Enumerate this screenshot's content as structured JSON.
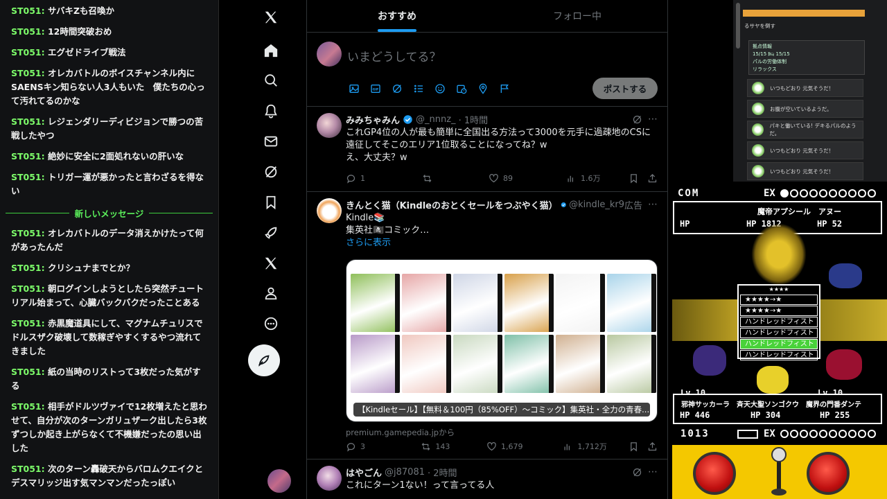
{
  "chat": {
    "messages_top": [
      {
        "user": "ST051:",
        "text": " サバキZも召喚か"
      },
      {
        "user": "ST051:",
        "text": " 12時間突破おめ"
      },
      {
        "user": "ST051:",
        "text": " エグゼドライブ戦法"
      },
      {
        "user": "ST051:",
        "text": " オレカバトルのボイスチャンネル内にSAENSキン知らない人3人もいた　僕たちの心って汚れてるのかな"
      },
      {
        "user": "ST051:",
        "text": " レジェンダリーディビジョンで勝つの苦戦したやつ"
      },
      {
        "user": "ST051:",
        "text": " 絶妙に安全に2面処れないの肝いな"
      },
      {
        "user": "ST051:",
        "text": " トリガー運が悪かったと言わざるを得ない"
      }
    ],
    "divider_label": "新しいメッセージ",
    "messages_bottom": [
      {
        "user": "ST051:",
        "text": " オレカバトルのデータ消えかけたって何があったんだ"
      },
      {
        "user": "ST051:",
        "text": " クリシュナまでとか？"
      },
      {
        "user": "ST051:",
        "text": " 朝ログインしようとしたら突然チュートリアル始まって、心臓バックバクだったことある"
      },
      {
        "user": "ST051:",
        "text": " 赤黒魔道具にして、マグナムチュリスでドルスザク破壊して数稼ぎやすくするやつ流れてきました"
      },
      {
        "user": "ST051:",
        "text": " 紙の当時のリストって3枚だった気がする"
      },
      {
        "user": "ST051:",
        "text": " 相手がドルツヴァイで12枚増えたと思わせて、自分が次のターンガリュザーク出したら3枚ずつしか起き上がらなくて不機嫌だったの思い出した"
      },
      {
        "user": "ST051:",
        "text": " 次のターン轟破天からバロムクエイクとデスマリッジ出す気マンマンだったっぽい"
      }
    ]
  },
  "nav": {
    "icons": [
      "x-logo-icon",
      "home-icon",
      "search-icon",
      "notifications-icon",
      "messages-icon",
      "grok-icon",
      "bookmarks-icon",
      "rocket-icon",
      "premium-x-icon",
      "profile-icon",
      "more-icon"
    ]
  },
  "timeline": {
    "tabs": [
      {
        "label": "おすすめ",
        "active": true
      },
      {
        "label": "フォロー中",
        "active": false
      }
    ],
    "composer": {
      "placeholder": "いまどうしてる？",
      "post_label": "ポストする"
    },
    "tweets": [
      {
        "name": "みみちゃみん",
        "handle": "@_nnnz_",
        "time": "· 1時間",
        "text": "これGP4位の人が最も簡単に全国出る方法って3000を元手に過疎地のCSに遠征してそこのエリア1位取ることになってね？w\nえ、大丈夫？w",
        "replies": "1",
        "retweets": "",
        "likes": "89",
        "views": "1.6万"
      },
      {
        "name": "きんとく猫（Kindleのおとくセールをつぶやく猫）",
        "handle": "@kindle_kr9",
        "ad_label": "広告",
        "text_line1": "Kindle📚",
        "text_line2": "集英社🏴‍☠️コミック…",
        "more": "さらに表示",
        "card_caption": "【Kindleセール】【無料＆100円（85%OFF）～コミック】集英社・全力の青春...",
        "card_source": "premium.gamepedia.jpから",
        "replies": "3",
        "retweets": "143",
        "likes": "1,679",
        "views": "1,712万"
      },
      {
        "name": "はやごん",
        "handle": "@j87081",
        "time": "· 2時間",
        "text": "これにターン1ない！って言ってる人"
      }
    ]
  },
  "game_top": {
    "title": "るサヤを倒す",
    "stats": [
      "拠点情報",
      "15/15   🛏 15/15",
      "パルの労働体制",
      "リラックス"
    ],
    "rows": [
      "いつもどおり 元気そうだ！",
      "お腹が空いているようだ。",
      "パキと働いている! デキるパルのようだ。",
      "いつもどおり 元気そうだ！",
      "いつもどおり 元気そうだ！"
    ]
  },
  "game_bot": {
    "com_label": "COM",
    "ex_label": "EX",
    "enemy_names": "魔帝アプシール　アヌー",
    "enemy_hp": [
      "HP",
      "HP 1812",
      "HP  52"
    ],
    "menu_header": "★★★★",
    "menu_items": [
      "★★★★→★",
      "★★★★→★",
      "ハンドレッドフィスト",
      "ハンドレッドフィスト",
      "ハンドレッドフィスト",
      "ハンドレッドフィスト"
    ],
    "menu_selected": 4,
    "lv_left": "Lv.10",
    "lv_right": "Lv.10",
    "party_names": "邪神サッカーラ　斉天大聖ソンゴクウ　魔界の門番ダンテ",
    "party_hp": [
      "HP  446",
      "HP  304",
      "HP  255"
    ],
    "score": "1013",
    "ex_label2": "EX"
  }
}
